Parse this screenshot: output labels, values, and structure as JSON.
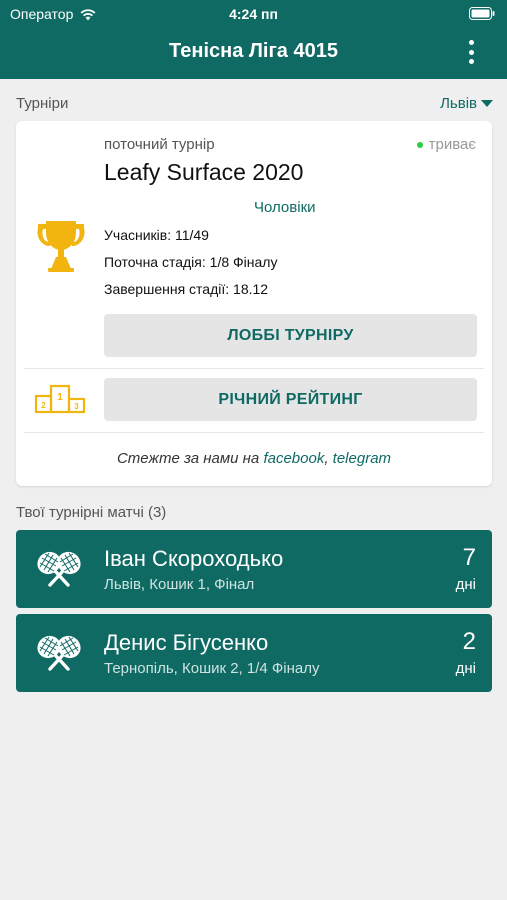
{
  "status_bar": {
    "carrier": "Оператор",
    "time": "4:24 пп"
  },
  "header": {
    "title": "Тенісна Ліга 4015"
  },
  "tournaments": {
    "section_label": "Турніри",
    "city": "Львів",
    "current": {
      "label": "поточний турнір",
      "status": "триває",
      "name": "Leafy Surface 2020",
      "category": "Чоловіки",
      "participants": "Учасників: 11/49",
      "stage": "Поточна стадія: 1/8 Фіналу",
      "stage_end": "Завершення стадії: 18.12",
      "lobby_button": "ЛОББІ ТУРНІРУ"
    },
    "rating_button": "РІЧНИЙ РЕЙТИНГ",
    "follow": {
      "text": "Стежте за нами на",
      "facebook": "facebook",
      "comma": ",",
      "telegram": "telegram"
    }
  },
  "matches": {
    "section_label": "Твої турнірні матчі (3)",
    "items": [
      {
        "player": "Іван Скороходько",
        "details": "Львів, Кошик 1, Фінал",
        "days": "7",
        "days_label": "дні"
      },
      {
        "player": "Денис Бігусенко",
        "details": "Тернопіль, Кошик 2, 1/4 Фіналу",
        "days": "2",
        "days_label": "дні"
      }
    ]
  },
  "icons": {
    "wifi": "wifi-icon",
    "battery": "battery-icon",
    "menu": "more-vertical-icon",
    "trophy": "trophy-icon",
    "podium": "podium-icon",
    "rackets": "tennis-rackets-icon",
    "dropdown": "triangle-down-icon"
  },
  "colors": {
    "primary": "#0f6a64",
    "trophy": "#f2b50f",
    "live": "#2ecc40",
    "background": "#efefef"
  }
}
